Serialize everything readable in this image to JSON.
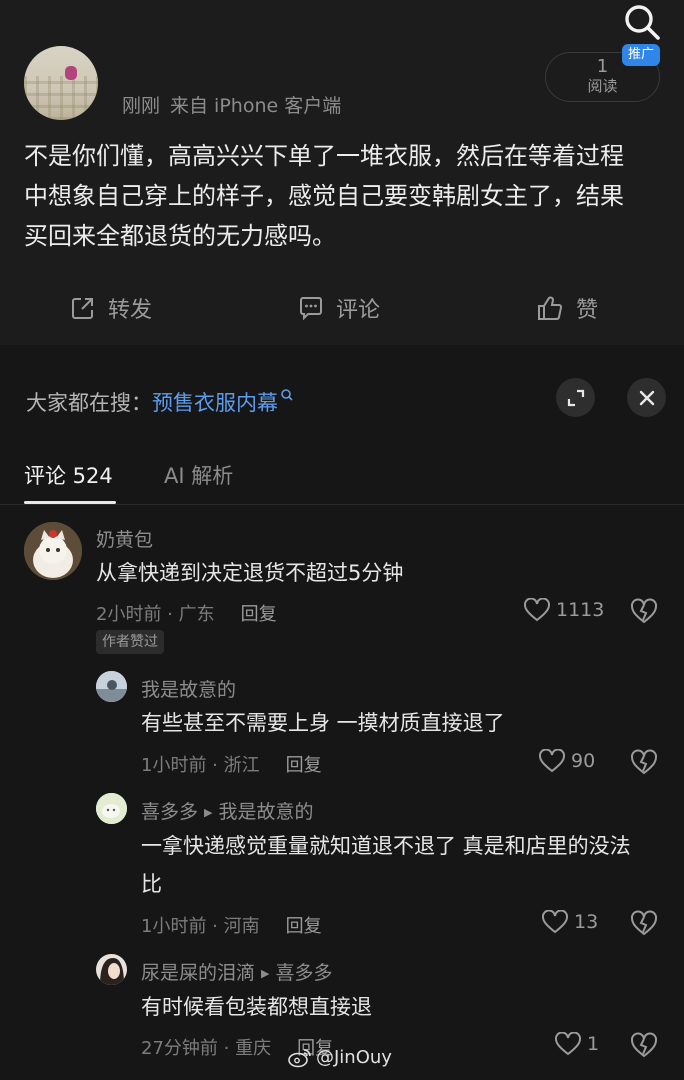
{
  "post": {
    "time": "刚刚",
    "source": "来自 iPhone 客户端",
    "read_count": "1",
    "read_label": "阅读",
    "promo_badge": "推广",
    "text": "不是你们懂，高高兴兴下单了一堆衣服，然后在等着过程中想象自己穿上的样子，感觉自己要变韩剧女主了，结果买回来全都退货的无力感吗。"
  },
  "actions": {
    "repost": "转发",
    "comment": "评论",
    "like": "赞"
  },
  "hot_search": {
    "prefix": "大家都在搜：",
    "keyword": "预售衣服内幕"
  },
  "tabs": {
    "comments": "评论 524",
    "ai": "AI 解析"
  },
  "comments": [
    {
      "user": "奶黄包",
      "text": "从拿快递到决定退货不超过5分钟",
      "time": "2小时前 · 广东",
      "reply": "回复",
      "likes": "1113",
      "badge": "作者赞过"
    },
    {
      "user": "我是故意的",
      "text": "有些甚至不需要上身 一摸材质直接退了",
      "time": "1小时前 · 浙江",
      "reply": "回复",
      "likes": "90"
    },
    {
      "user": "喜多多",
      "reply_to": "我是故意的",
      "text": "一拿快递感觉重量就知道退不退了 真是和店里的没法比",
      "time": "1小时前 · 河南",
      "reply": "回复",
      "likes": "13"
    },
    {
      "user": "尿是屎的泪滴",
      "reply_to": "喜多多",
      "text": "有时候看包装都想直接退",
      "time": "27分钟前 · 重庆",
      "reply": "回复",
      "likes": "1"
    }
  ],
  "watermark": "@JinOuy",
  "colors": {
    "background": "#161616",
    "accent_blue": "#5d9cec",
    "promo_badge": "#2f86e8"
  }
}
